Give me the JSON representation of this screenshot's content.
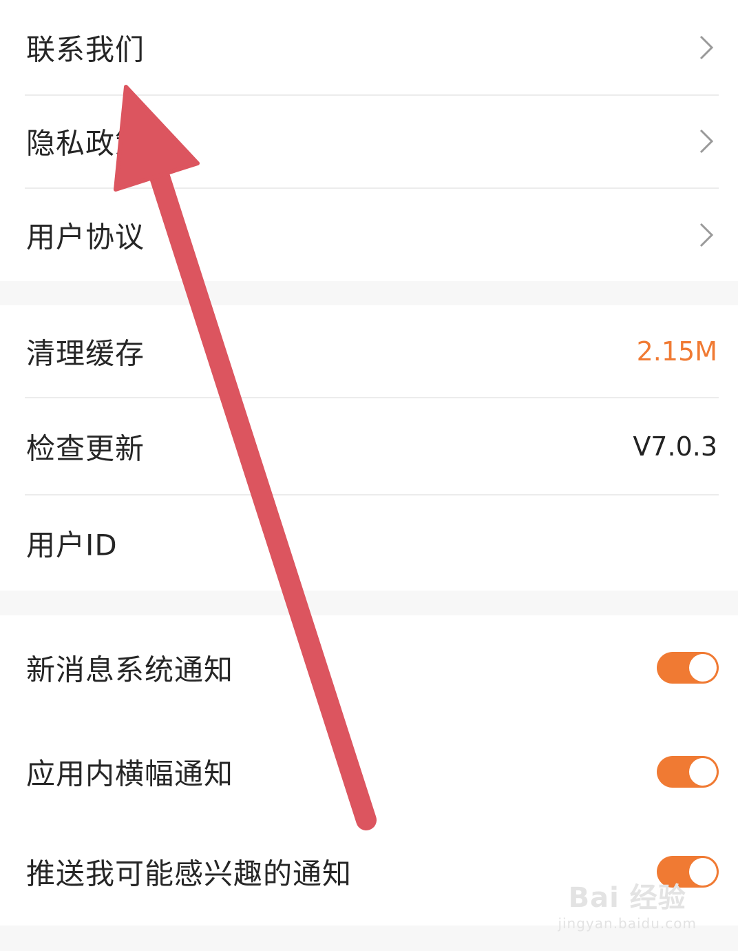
{
  "about_section": {
    "items": [
      {
        "label": "联系我们"
      },
      {
        "label": "隐私政策"
      },
      {
        "label": "用户协议"
      }
    ]
  },
  "storage_section": {
    "clear_cache": {
      "label": "清理缓存",
      "value": "2.15M",
      "value_color": "#f07a33"
    },
    "check_update": {
      "label": "检查更新",
      "value": "V7.0.3"
    },
    "user_id": {
      "label": "用户ID"
    }
  },
  "notification_section": {
    "items": [
      {
        "label": "新消息系统通知",
        "enabled": true
      },
      {
        "label": "应用内横幅通知",
        "enabled": true
      },
      {
        "label": "推送我可能感兴趣的通知",
        "enabled": true
      }
    ]
  },
  "colors": {
    "accent": "#f07a33",
    "annotation_arrow": "#dc555f"
  },
  "icons": {
    "row_chevron": "chevron-right-icon",
    "overlay": "arrow-annotation-icon"
  },
  "watermark": {
    "brand": "Bai 经验",
    "url": "jingyan.baidu.com"
  }
}
